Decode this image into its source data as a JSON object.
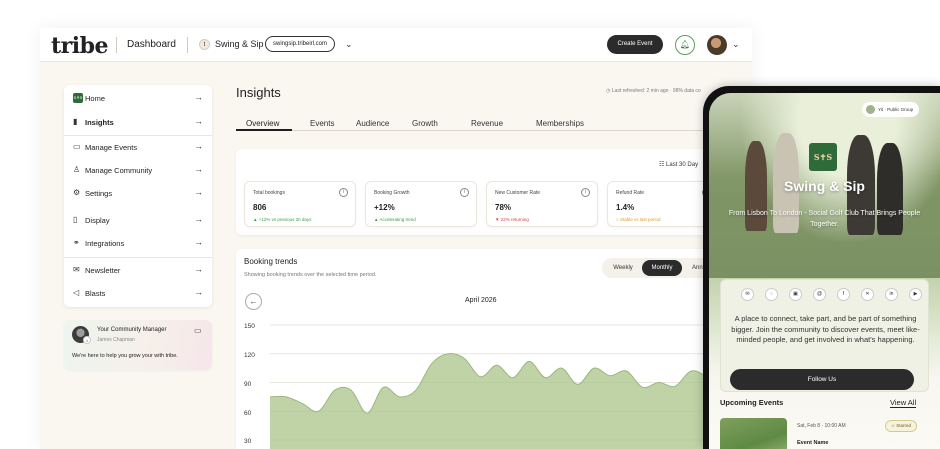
{
  "topbar": {
    "logo": "tribe",
    "dashboard": "Dashboard",
    "space_name": "Swing & Sip",
    "space_url": "swingsip.tribeirl.com",
    "create_event": "Create Event"
  },
  "sidebar": {
    "home": "Home",
    "insights": "Insights",
    "manage_events": "Manage Events",
    "manage_community": "Manage Community",
    "settings": "Settings",
    "display": "Display",
    "integrations": "Integrations",
    "newsletter": "Newsletter",
    "blasts": "Blasts"
  },
  "community_manager": {
    "title": "Your Community Manager",
    "name": "James Chapman",
    "help": "We're here to help you grow your with tribe."
  },
  "insights": {
    "title": "Insights",
    "refresh": "Last refreshed: 2 min ago · 98% data co",
    "tabs": [
      "Overview",
      "Events",
      "Audience",
      "Growth",
      "Revenue",
      "Memberships"
    ],
    "range": "Last 30 Day",
    "metrics": [
      {
        "title": "Total bookings",
        "value": "806",
        "sub": "▲ +12% vs previous 30 days",
        "color": "#3f9a4b"
      },
      {
        "title": "Booking Growth",
        "value": "+12%",
        "sub": "▲ Accelerating trend",
        "color": "#3f9a4b"
      },
      {
        "title": "New Customer Rate",
        "value": "78%",
        "sub": "▼ 22% returning",
        "color": "#d04545"
      },
      {
        "title": "Refund Rate",
        "value": "1.4%",
        "sub": "○ Stable vs last period",
        "color": "#e39a2b"
      }
    ]
  },
  "booking_trends": {
    "title": "Booking trends",
    "subtitle": "Showing booking trends over the selected time period.",
    "periods": [
      "Weekly",
      "Monthly",
      "Annu"
    ],
    "selected_period": "Monthly",
    "month": "April 2026"
  },
  "chart_data": {
    "type": "area",
    "title": "Booking trends",
    "xlabel": "",
    "ylabel": "",
    "y_ticks": [
      150,
      120,
      90,
      60,
      30
    ],
    "ylim": [
      30,
      150
    ],
    "grid": true,
    "color": "#a9c48a",
    "series": [
      {
        "values": [
          75,
          75,
          68,
          60,
          82,
          82,
          58,
          85,
          75,
          82,
          110,
          120,
          115,
          96,
          108,
          95,
          112,
          95,
          105,
          88,
          105,
          97,
          102,
          85,
          90,
          86,
          102,
          95,
          78,
          92,
          115
        ]
      }
    ]
  },
  "phone": {
    "tag": "Yit · Public Group",
    "logo_text": "S✝S",
    "name": "Swing & Sip",
    "description": "From Lisbon To London - Social Golf Club That Brings People Together.",
    "about": "A place to connect, take part, and be part of something bigger. Join the community to discover events, meet like-minded people, and get involved in what's happening.",
    "follow": "Follow Us",
    "upcoming": "Upcoming Events",
    "view_all": "View All",
    "event_date": "Sat, Feb 8 · 10:00 AM",
    "event_name": "Event Name",
    "starred": "☆ Starred"
  }
}
